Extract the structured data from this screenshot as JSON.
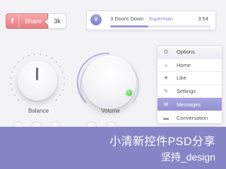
{
  "share": {
    "network_icon": "f",
    "label": "Share",
    "count": "3k"
  },
  "player": {
    "artist": "3 Doors Down",
    "separator": " - ",
    "song": "Superman",
    "time": "3:54",
    "pause_icon": "II",
    "progress_fraction": 0.38
  },
  "knobs": {
    "balance_label": "Balance",
    "volume_label": "Volume"
  },
  "menu": {
    "items": [
      {
        "label": "Options",
        "icon": "gear-icon",
        "glyph": "⚙"
      },
      {
        "label": "Home",
        "icon": "home-icon",
        "glyph": "⌂"
      },
      {
        "label": "Like",
        "icon": "heart-icon",
        "glyph": "♥"
      },
      {
        "label": "Settings",
        "icon": "wrench-icon",
        "glyph": "✎"
      },
      {
        "label": "Messages",
        "icon": "envelope-icon",
        "glyph": "✉"
      },
      {
        "label": "Conversation",
        "icon": "chat-bubble-icon",
        "glyph": "▬"
      }
    ],
    "active_index": 4
  },
  "banner": {
    "title": "小清新控件PSD分享",
    "subtitle": "坚持_design"
  },
  "colors": {
    "accent": "#8686c6",
    "share": "#e8868b",
    "led": "#3fbf2f"
  }
}
